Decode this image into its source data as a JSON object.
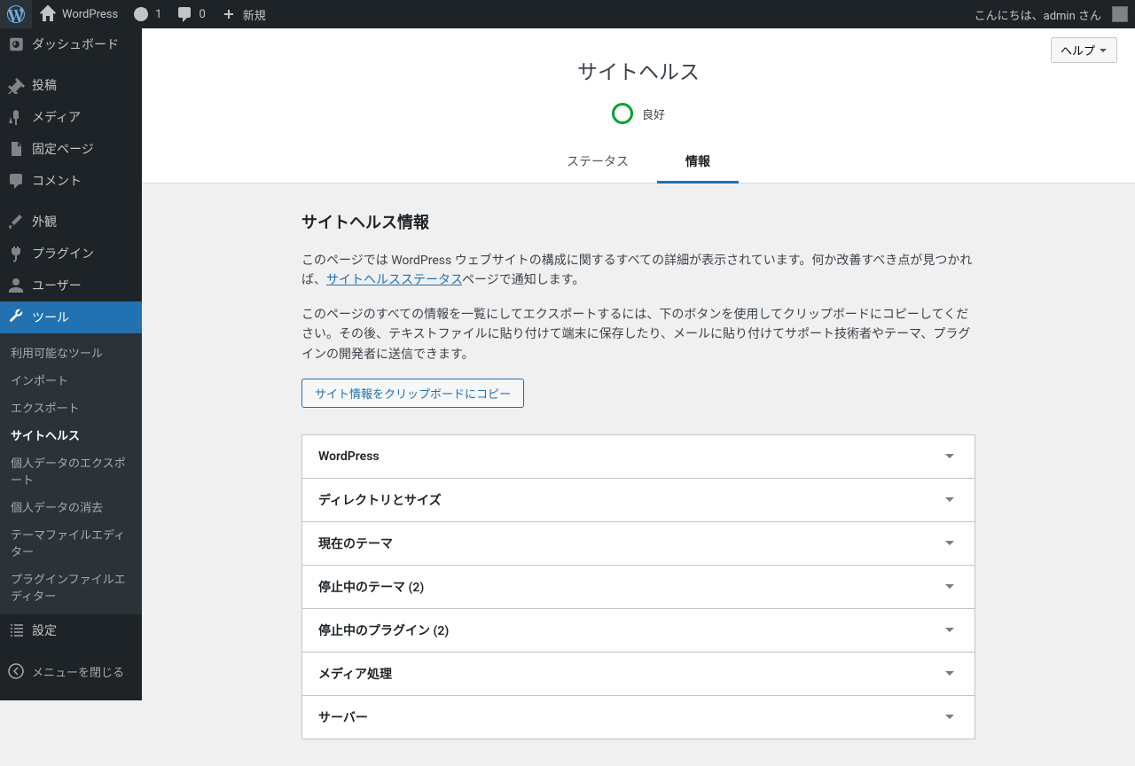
{
  "toolbar": {
    "site_name": "WordPress",
    "updates_count": "1",
    "comments_count": "0",
    "new_label": "新規",
    "greeting": "こんにちは、admin さん"
  },
  "sidebar": {
    "items": [
      {
        "label": "ダッシュボード"
      },
      {
        "label": "投稿"
      },
      {
        "label": "メディア"
      },
      {
        "label": "固定ページ"
      },
      {
        "label": "コメント"
      },
      {
        "label": "外観"
      },
      {
        "label": "プラグイン"
      },
      {
        "label": "ユーザー"
      },
      {
        "label": "ツール"
      },
      {
        "label": "設定"
      }
    ],
    "submenu": [
      {
        "label": "利用可能なツール"
      },
      {
        "label": "インポート"
      },
      {
        "label": "エクスポート"
      },
      {
        "label": "サイトヘルス"
      },
      {
        "label": "個人データのエクスポート"
      },
      {
        "label": "個人データの消去"
      },
      {
        "label": "テーマファイルエディター"
      },
      {
        "label": "プラグインファイルエディター"
      }
    ],
    "collapse_label": "メニューを閉じる"
  },
  "header": {
    "help_label": "ヘルプ",
    "page_title": "サイトヘルス",
    "status_text": "良好",
    "tabs": [
      {
        "label": "ステータス"
      },
      {
        "label": "情報"
      }
    ]
  },
  "content": {
    "heading": "サイトヘルス情報",
    "desc1_a": "このページでは WordPress ウェブサイトの構成に関するすべての詳細が表示されています。何か改善すべき点が見つかれば、",
    "desc1_link": "サイトヘルスステータス",
    "desc1_b": "ページで通知します。",
    "desc2": "このページのすべての情報を一覧にしてエクスポートするには、下のボタンを使用してクリップボードにコピーしてください。その後、テキストファイルに貼り付けて端末に保存したり、メールに貼り付けてサポート技術者やテーマ、プラグインの開発者に送信できます。",
    "copy_button": "サイト情報をクリップボードにコピー",
    "accordion": [
      {
        "label": "WordPress"
      },
      {
        "label": "ディレクトリとサイズ"
      },
      {
        "label": "現在のテーマ"
      },
      {
        "label": "停止中のテーマ (2)"
      },
      {
        "label": "停止中のプラグイン (2)"
      },
      {
        "label": "メディア処理"
      },
      {
        "label": "サーバー"
      }
    ]
  }
}
